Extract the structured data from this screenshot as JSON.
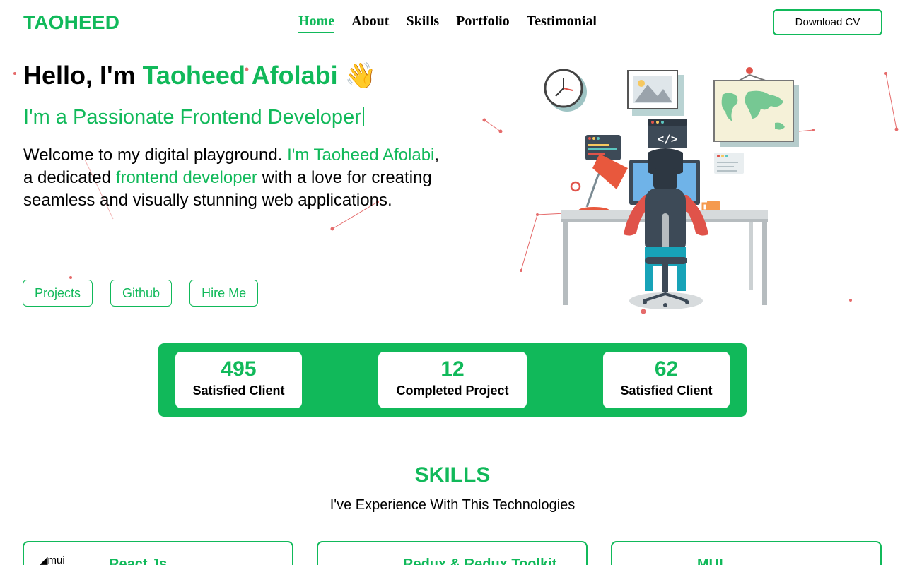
{
  "brand": {
    "logo": "TAOHEED",
    "accent": "#11b95a"
  },
  "nav": {
    "items": [
      "Home",
      "About",
      "Skills",
      "Portfolio",
      "Testimonial"
    ],
    "active": "Home",
    "download_cv": "Download CV"
  },
  "hero": {
    "hello_prefix": "Hello, I'm ",
    "hello_name": "Taoheed Afolabi",
    "wave_emoji": "👋",
    "tagline": "I'm a Passionate Frontend Developer",
    "intro": {
      "part1": "Welcome to my digital playground. ",
      "part2": "I'm Taoheed Afolabi",
      "part3": ", a dedicated ",
      "part4": "frontend developer",
      "part5": " with a love for creating seamless and visually stunning web applications."
    },
    "buttons": [
      "Projects",
      "Github",
      "Hire Me"
    ]
  },
  "stats": [
    {
      "value": "495",
      "label": "Satisfied Client"
    },
    {
      "value": "12",
      "label": "Completed Project"
    },
    {
      "value": "62",
      "label": "Satisfied Client"
    }
  ],
  "skills": {
    "title": "SKILLS",
    "subtitle": "I've Experience With This Technologies",
    "cards": [
      {
        "name": "React Js",
        "icon": "mui-logo-icon",
        "alt_text": "mui"
      },
      {
        "name": "Redux & Redux Toolkit",
        "icon": "redux-logo-icon"
      },
      {
        "name": "MUI",
        "icon": "mui-logo-icon"
      }
    ]
  }
}
